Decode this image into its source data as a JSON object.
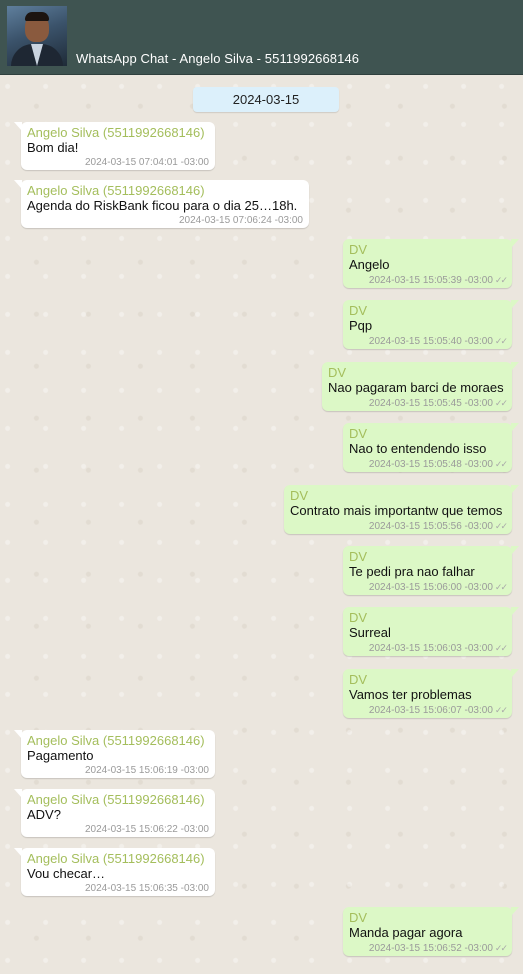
{
  "header": {
    "title": "WhatsApp Chat - Angelo Silva - 5511992668146",
    "avatar_icon": "contact-photo"
  },
  "chat": {
    "date": "2024-03-15",
    "messages": [
      {
        "direction": "in",
        "sender": "Angelo Silva (5511992668146)",
        "text": "Bom dia!",
        "time": "2024-03-15 07:04:01 -03:00"
      },
      {
        "direction": "in",
        "sender": "Angelo Silva (5511992668146)",
        "text": "Agenda do RiskBank ficou para o dia 25…18h.",
        "time": "2024-03-15 07:06:24 -03:00"
      },
      {
        "direction": "out",
        "sender": "DV",
        "text": "Angelo",
        "time": "2024-03-15 15:05:39 -03:00",
        "ticks": "✓✓"
      },
      {
        "direction": "out",
        "sender": "DV",
        "text": "Pqp",
        "time": "2024-03-15 15:05:40 -03:00",
        "ticks": "✓✓"
      },
      {
        "direction": "out",
        "sender": "DV",
        "text": "Nao pagaram barci de moraes",
        "time": "2024-03-15 15:05:45 -03:00",
        "ticks": "✓✓"
      },
      {
        "direction": "out",
        "sender": "DV",
        "text": "Nao to entendendo isso",
        "time": "2024-03-15 15:05:48 -03:00",
        "ticks": "✓✓"
      },
      {
        "direction": "out",
        "sender": "DV",
        "text": "Contrato mais importantw que temos",
        "time": "2024-03-15 15:05:56 -03:00",
        "ticks": "✓✓"
      },
      {
        "direction": "out",
        "sender": "DV",
        "text": "Te pedi pra nao falhar",
        "time": "2024-03-15 15:06:00 -03:00",
        "ticks": "✓✓"
      },
      {
        "direction": "out",
        "sender": "DV",
        "text": "Surreal",
        "time": "2024-03-15 15:06:03 -03:00",
        "ticks": "✓✓"
      },
      {
        "direction": "out",
        "sender": "DV",
        "text": "Vamos ter problemas",
        "time": "2024-03-15 15:06:07 -03:00",
        "ticks": "✓✓"
      },
      {
        "direction": "in",
        "sender": "Angelo Silva (5511992668146)",
        "text": "Pagamento",
        "time": "2024-03-15 15:06:19 -03:00"
      },
      {
        "direction": "in",
        "sender": "Angelo Silva (5511992668146)",
        "text": "ADV?",
        "time": "2024-03-15 15:06:22 -03:00"
      },
      {
        "direction": "in",
        "sender": "Angelo Silva (5511992668146)",
        "text": "Vou checar…",
        "time": "2024-03-15 15:06:35 -03:00"
      },
      {
        "direction": "out",
        "sender": "DV",
        "text": "Manda pagar agora",
        "time": "2024-03-15 15:06:52 -03:00",
        "ticks": "✓✓"
      }
    ]
  },
  "colors": {
    "header_bg": "#3f5451",
    "incoming_bubble": "#ffffff",
    "outgoing_bubble": "#dcf8c6",
    "sender_name": "#a4be5c",
    "date_pill": "#dcf0fb"
  }
}
